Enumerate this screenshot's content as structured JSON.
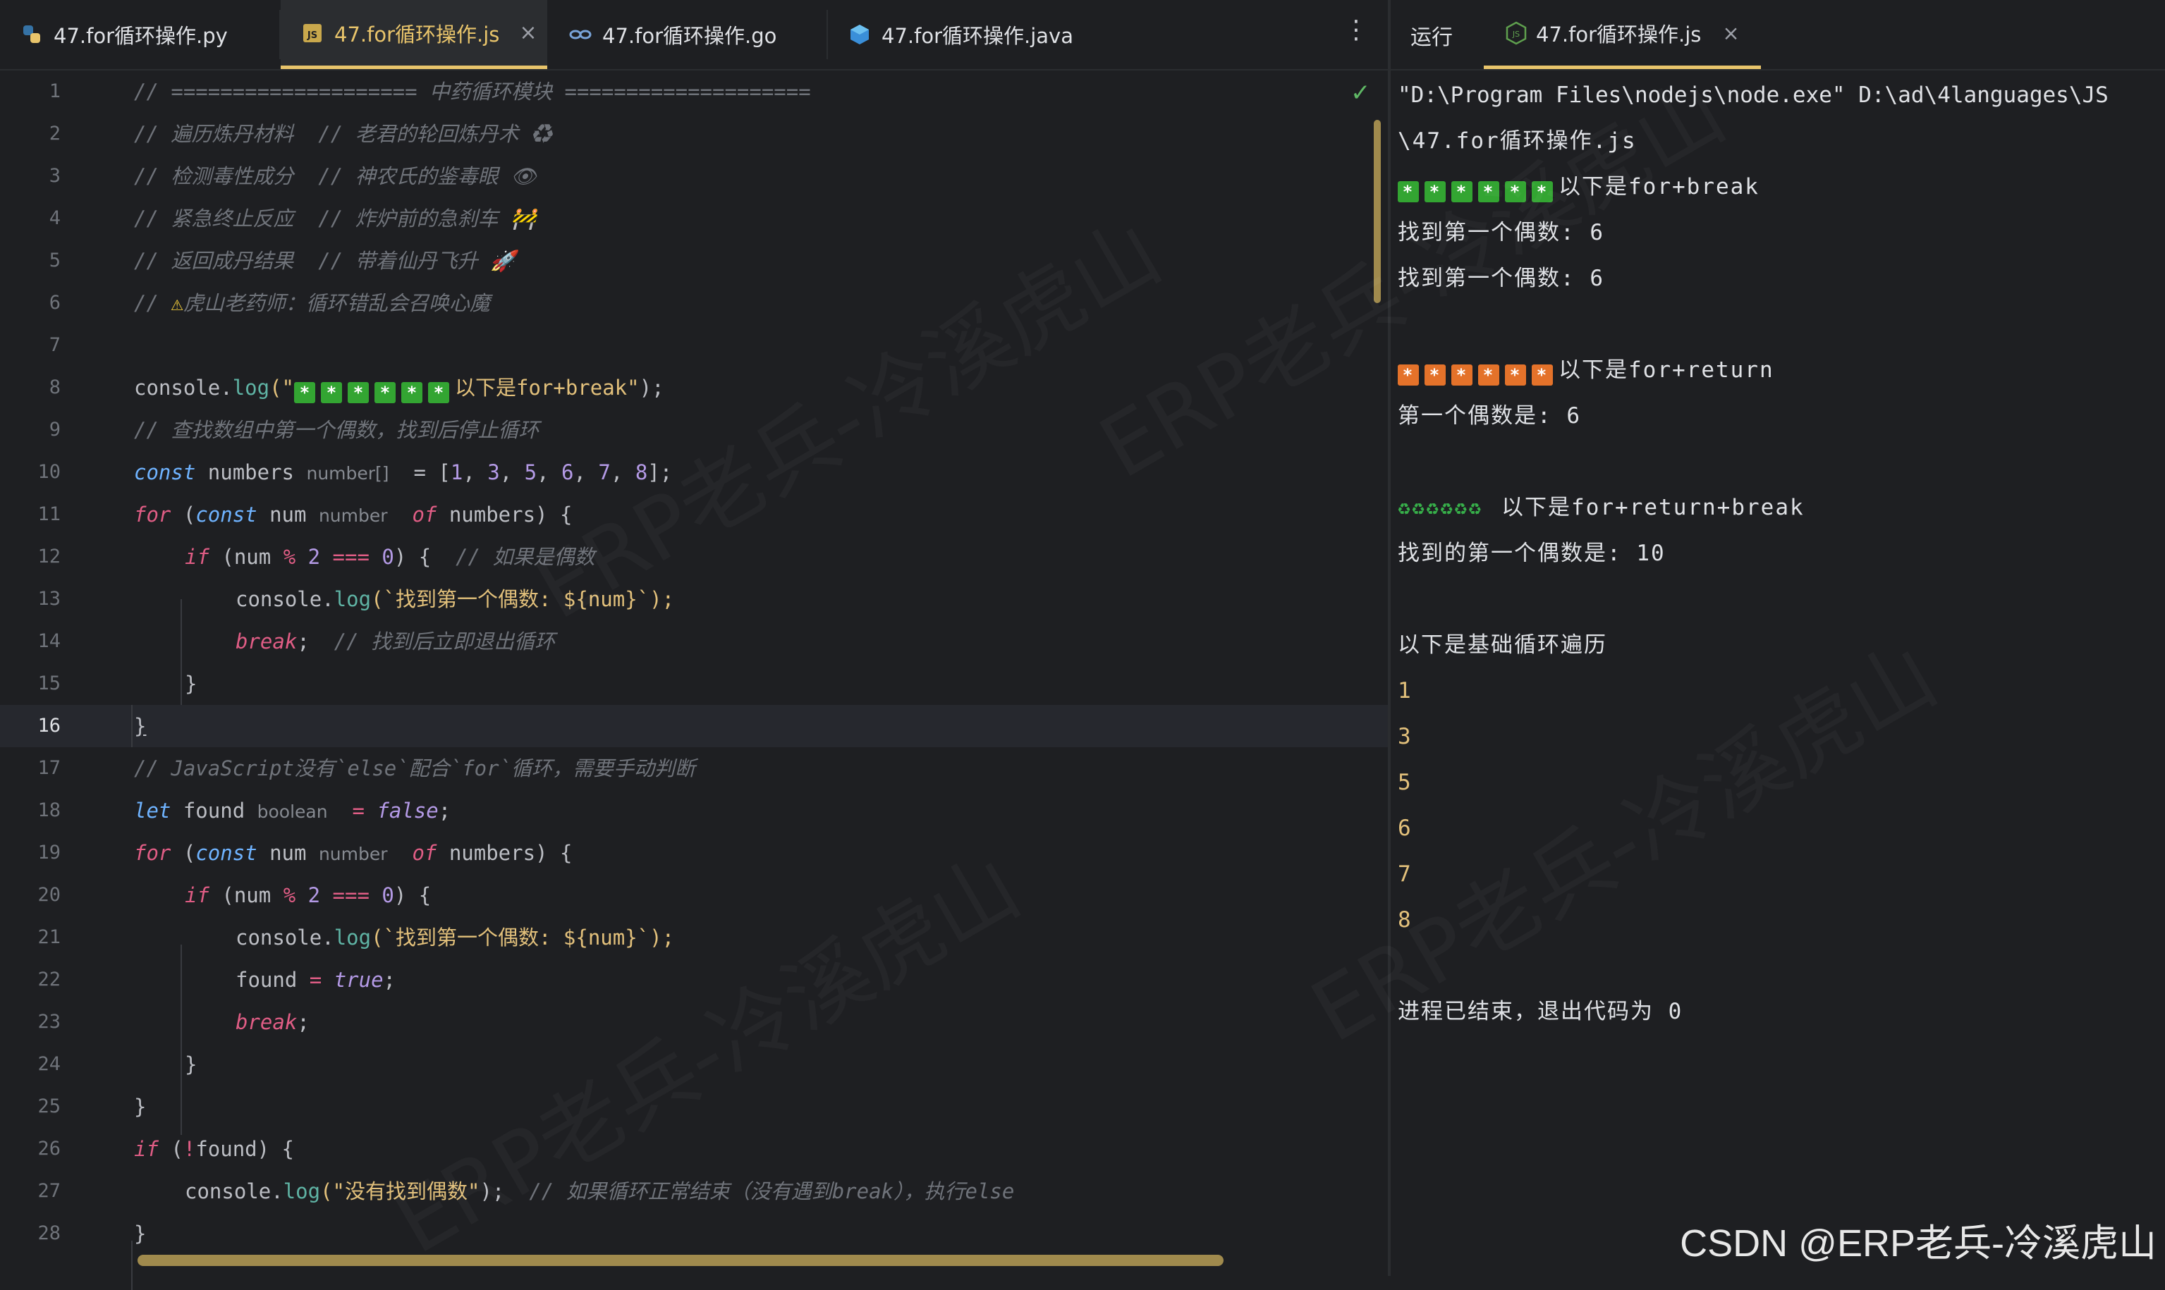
{
  "editor": {
    "tabs": [
      {
        "label": "47.for循环操作.py",
        "icon": "python-icon",
        "active": false
      },
      {
        "label": "47.for循环操作.js",
        "icon": "js-icon",
        "active": true
      },
      {
        "label": "47.for循环操作.go",
        "icon": "go-icon",
        "active": false
      },
      {
        "label": "47.for循环操作.java",
        "icon": "java-icon",
        "active": false
      }
    ],
    "tab_close": "×",
    "more": "⋮",
    "line_numbers": [
      "1",
      "2",
      "3",
      "4",
      "5",
      "6",
      "7",
      "8",
      "9",
      "10",
      "11",
      "12",
      "13",
      "14",
      "15",
      "16",
      "17",
      "18",
      "19",
      "20",
      "21",
      "22",
      "23",
      "24",
      "25",
      "26",
      "27",
      "28"
    ],
    "current_line": "16",
    "lines": {
      "l1": "// ==================== 中药循环模块 ====================",
      "l2": "// 遍历炼丹材料  // 老君的轮回炼丹术 ♻",
      "l3": "// 检测毒性成分  // 神农氏的鉴毒眼 👁",
      "l4": "// 紧急终止反应  // 炸炉前的急刹车 🚧",
      "l5": "// 返回成丹结果  // 带着仙丹飞升 🚀",
      "l6a": "// ",
      "l6b": "⚠",
      "l6c": "虎山老药师：循环错乱会召唤心魔",
      "l8a": "console.",
      "l8b": "log",
      "l8c": "(\"",
      "l8d": "以下是for+break\"",
      "l8e": ");",
      "l9": "// 查找数组中第一个偶数，找到后停止循环",
      "l10_kw": "const",
      "l10_name": " numbers",
      "l10_hint": "number[]",
      "l10_eq": " = [",
      "l10_vals": [
        "1",
        "3",
        "5",
        "6",
        "7",
        "8"
      ],
      "l10_end": "];",
      "l11_for": "for",
      "l11_const": "const",
      "l11_num": " num",
      "l11_hint": "number",
      "l11_of": "of",
      "l11_rest": " numbers) {",
      "l12_if": "if",
      "l12_a": " (num ",
      "l12_mod": "%",
      "l12_two": " 2 ",
      "l12_eq": "===",
      "l12_zero": " 0",
      "l12_b": ") {  ",
      "l12_c": "// 如果是偶数",
      "l13_a": "console.",
      "l13_b": "log",
      "l13_c": "(`找到第一个偶数: ${num}`);",
      "l14_a": "break",
      "l14_b": ";  ",
      "l14_c": "// 找到后立即退出循环",
      "l15": "}",
      "l16": "}",
      "l17": "// JavaScript没有`else`配合`for`循环，需要手动判断",
      "l18_let": "let",
      "l18_name": " found",
      "l18_hint": "boolean",
      "l18_eq": " = ",
      "l18_val": "false",
      "l18_end": ";",
      "l19_for": "for",
      "l19_const": "const",
      "l19_num": " num",
      "l19_hint": "number",
      "l19_of": "of",
      "l19_rest": " numbers) {",
      "l20_if": "if",
      "l20_a": " (num ",
      "l20_mod": "%",
      "l20_two": " 2 ",
      "l20_eq": "===",
      "l20_zero": " 0",
      "l20_b": ") {",
      "l21_a": "console.",
      "l21_b": "log",
      "l21_c": "(`找到第一个偶数: ${num}`);",
      "l22_a": "found ",
      "l22_eq": "=",
      "l22_val": " true",
      "l22_end": ";",
      "l23_a": "break",
      "l23_b": ";",
      "l24": "}",
      "l25": "}",
      "l26_if": "if",
      "l26_a": " (",
      "l26_not": "!",
      "l26_b": "found) {",
      "l27_a": "console.",
      "l27_b": "log",
      "l27_c": "(\"没有找到偶数\"",
      "l27_d": ");  ",
      "l27_e": "// 如果循环正常结束（没有遇到break），执行else",
      "l28": "}"
    }
  },
  "run_panel": {
    "label": "运行",
    "tab": "47.for循环操作.js",
    "tab_close": "×",
    "output": {
      "cmd1": "\"D:\\Program Files\\nodejs\\node.exe\" D:\\ad\\4languages\\JS",
      "cmd2": "\\47.for循环操作.js",
      "h1": "以下是for+break",
      "r1": "找到第一个偶数: 6",
      "r2": "找到第一个偶数: 6",
      "h2": "以下是for+return",
      "r3": "第一个偶数是: 6",
      "h3": "以下是for+return+break",
      "r4": "找到的第一个偶数是: 10",
      "h4": "以下是基础循环遍历",
      "nums": [
        "1",
        "3",
        "5",
        "6",
        "7",
        "8"
      ],
      "exit": "进程已结束，退出代码为 0"
    },
    "check_mark": "✓"
  },
  "watermark": {
    "text": "ERP老兵-冷溪虎山",
    "credit": "CSDN @ERP老兵-冷溪虎山"
  },
  "colors": {
    "accent": "#e8c46b",
    "green_box": "#33a532",
    "orange_box": "#e4722a"
  }
}
